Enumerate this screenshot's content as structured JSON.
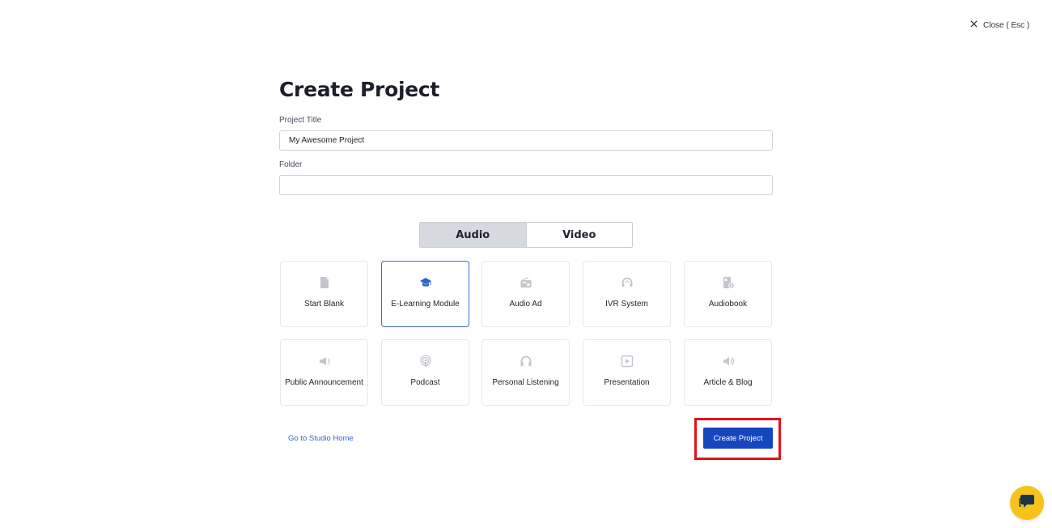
{
  "close": {
    "label": "Close ( Esc )"
  },
  "title": "Create Project",
  "fields": {
    "project_title_label": "Project Title",
    "project_title_value": "My Awesome Project",
    "folder_label": "Folder",
    "folder_value": ""
  },
  "toggle": {
    "audio": "Audio",
    "video": "Video",
    "active": "Audio"
  },
  "templates": [
    {
      "label": "Start Blank",
      "icon": "document-icon"
    },
    {
      "label": "E-Learning Module",
      "icon": "graduation-cap-icon",
      "selected": true
    },
    {
      "label": "Audio Ad",
      "icon": "radio-icon"
    },
    {
      "label": "IVR System",
      "icon": "headset-icon"
    },
    {
      "label": "Audiobook",
      "icon": "audiobook-icon"
    },
    {
      "label": "Public Announcement",
      "icon": "megaphone-icon"
    },
    {
      "label": "Podcast",
      "icon": "podcast-icon"
    },
    {
      "label": "Personal Listening",
      "icon": "headphones-icon"
    },
    {
      "label": "Presentation",
      "icon": "play-square-icon"
    },
    {
      "label": "Article & Blog",
      "icon": "speaker-icon"
    }
  ],
  "footer": {
    "studio_home": "Go to Studio Home",
    "create_button": "Create Project"
  },
  "colors": {
    "accent": "#1546c0",
    "selected_border": "#3b6fd4",
    "highlight": "#e0121b",
    "chat": "#f7c31a"
  }
}
